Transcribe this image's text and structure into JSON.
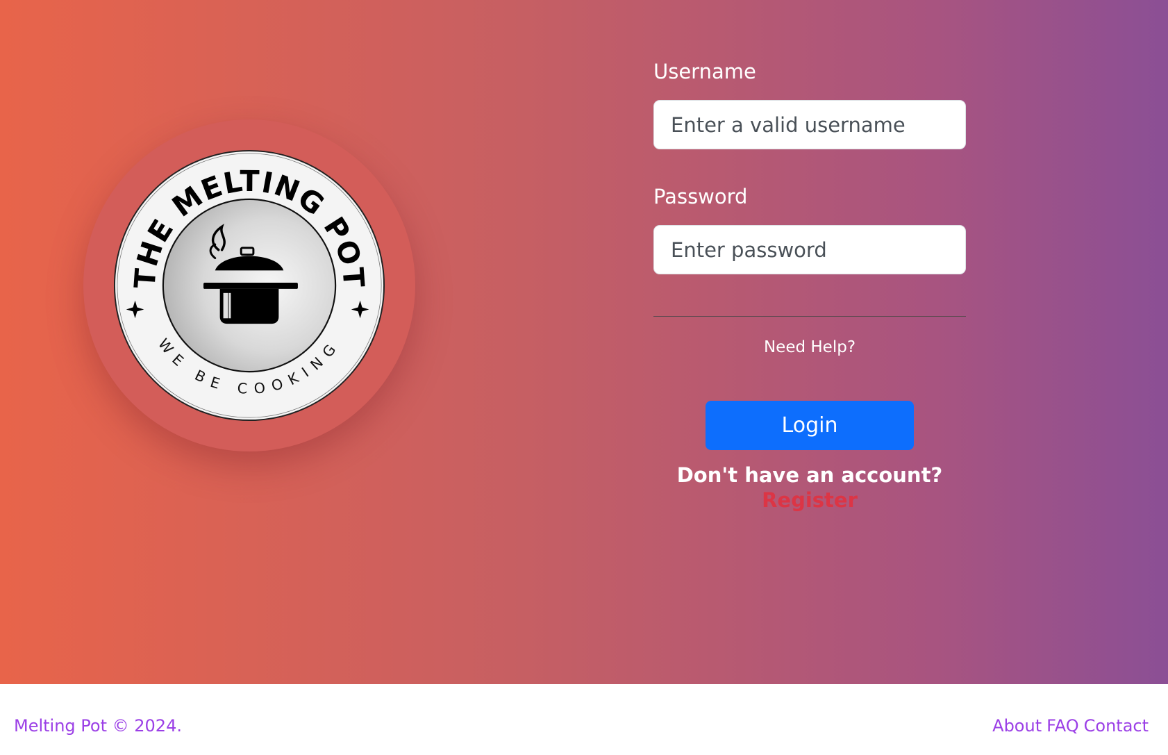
{
  "logo": {
    "title": "THE MELTING POT",
    "tagline": "WE BE COOKING",
    "icon": "cooking-pot-icon"
  },
  "login_form": {
    "username_label": "Username",
    "username_placeholder": "Enter a valid username",
    "username_value": "",
    "password_label": "Password",
    "password_placeholder": "Enter password",
    "password_value": "",
    "help_link": "Need Help?",
    "login_button": "Login",
    "no_account_text": "Don't have an account?",
    "register_link": "Register"
  },
  "footer": {
    "copyright": "Melting Pot © 2024.",
    "links": [
      "About",
      "FAQ",
      "Contact"
    ]
  },
  "colors": {
    "gradient_start": "#e8644a",
    "gradient_end": "#8b4f95",
    "primary_button": "#0d6efd",
    "register_link": "#dc3545",
    "footer_link": "#9b3fe6"
  }
}
